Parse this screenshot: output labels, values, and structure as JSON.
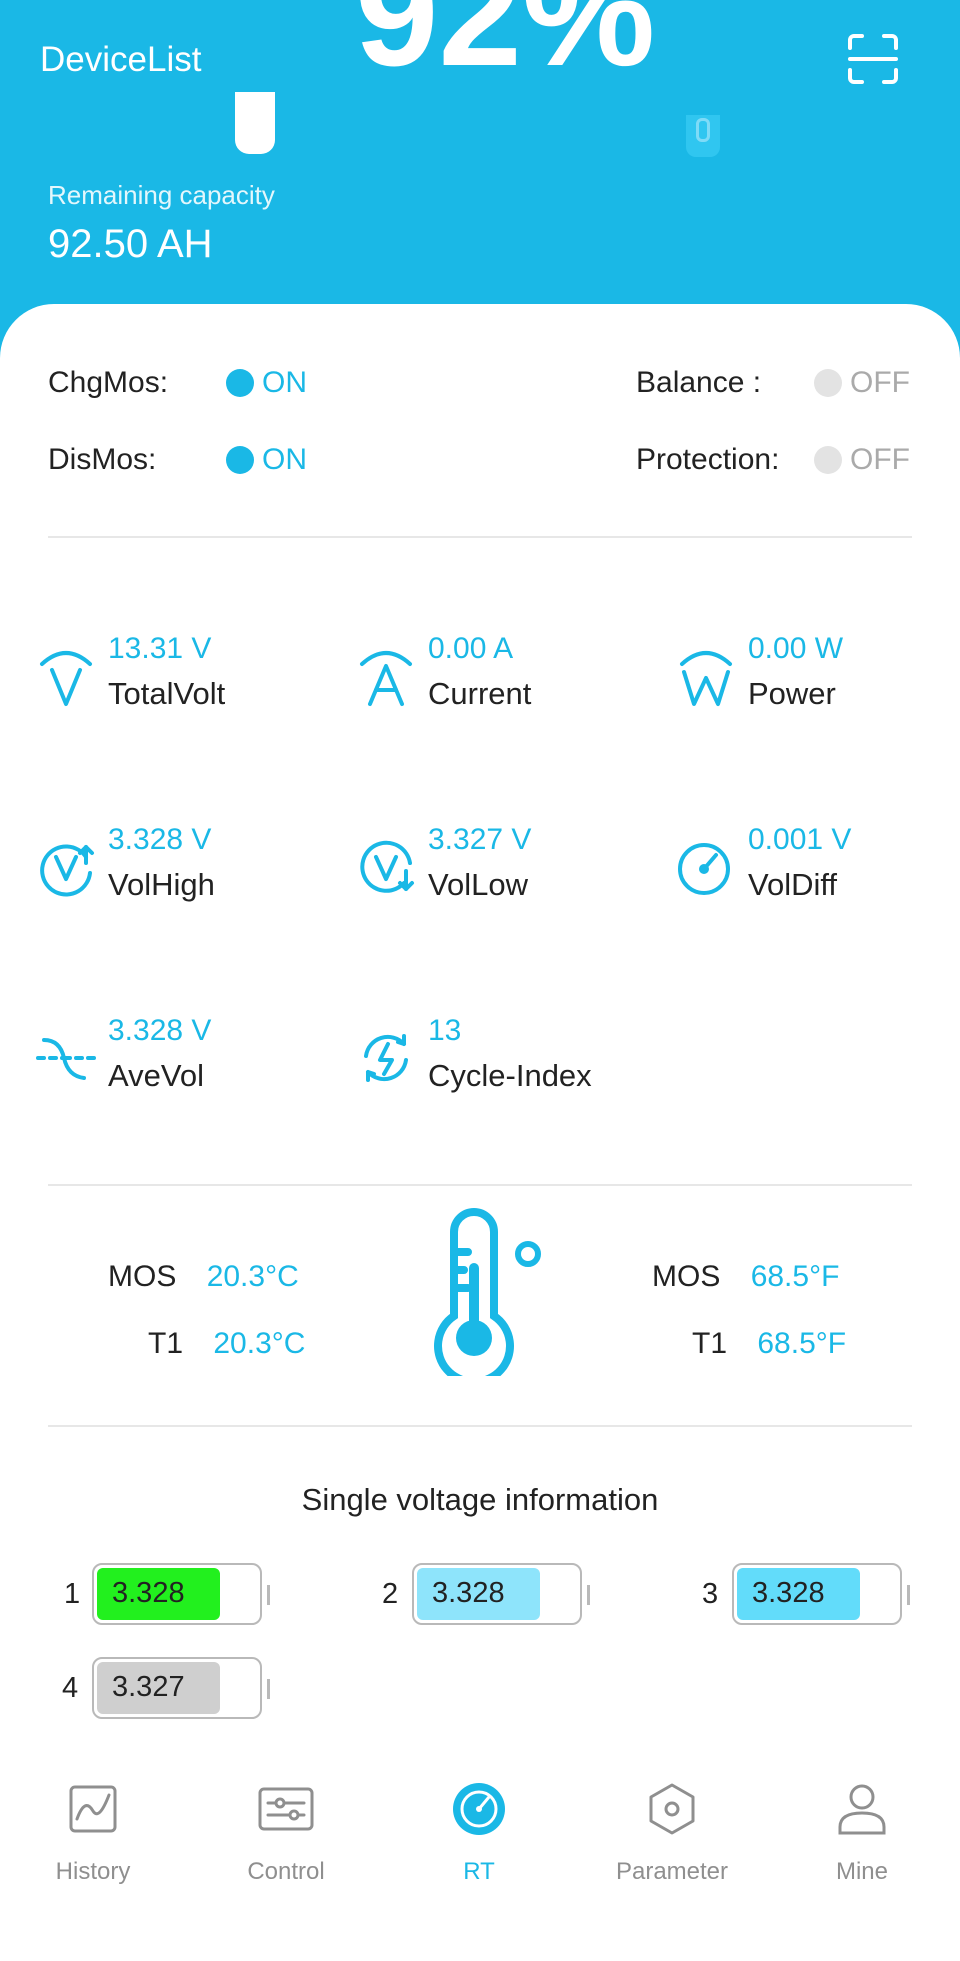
{
  "header": {
    "title": "DeviceList",
    "remaining_label": "Remaining capacity",
    "remaining_value": "92.50 AH",
    "percent_partial": "92%"
  },
  "switches": {
    "chgmos": {
      "label": "ChgMos:",
      "state": "ON"
    },
    "dismos": {
      "label": "DisMos:",
      "state": "ON"
    },
    "balance": {
      "label": "Balance :",
      "state": "OFF"
    },
    "protection": {
      "label": "Protection:",
      "state": "OFF"
    }
  },
  "metrics": [
    {
      "icon": "volt-icon",
      "value": "13.31 V",
      "label": "TotalVolt"
    },
    {
      "icon": "ampere-icon",
      "value": "0.00 A",
      "label": "Current"
    },
    {
      "icon": "watt-icon",
      "value": "0.00 W",
      "label": "Power"
    },
    {
      "icon": "volt-high-icon",
      "value": "3.328 V",
      "label": "VolHigh"
    },
    {
      "icon": "volt-low-icon",
      "value": "3.327 V",
      "label": "VolLow"
    },
    {
      "icon": "gauge-icon",
      "value": "0.001 V",
      "label": "VolDiff"
    },
    {
      "icon": "average-wave-icon",
      "value": "3.328 V",
      "label": "AveVol"
    },
    {
      "icon": "cycle-lightning-icon",
      "value": "13",
      "label": "Cycle-Index"
    }
  ],
  "temperature": {
    "celsius": [
      {
        "label": "MOS",
        "value": "20.3°C"
      },
      {
        "label": "T1",
        "value": "20.3°C"
      }
    ],
    "fahrenheit": [
      {
        "label": "MOS",
        "value": "68.5°F"
      },
      {
        "label": "T1",
        "value": "68.5°F"
      }
    ]
  },
  "single_voltage": {
    "title": "Single voltage information",
    "cells": [
      {
        "index": "1",
        "value": "3.328",
        "color": "#22f01e",
        "level": 0.77
      },
      {
        "index": "2",
        "value": "3.328",
        "color": "#8ee4fb",
        "level": 0.77
      },
      {
        "index": "3",
        "value": "3.328",
        "color": "#62dcfa",
        "level": 0.77
      },
      {
        "index": "4",
        "value": "3.327",
        "color": "#cfcfcf",
        "level": 0.77
      }
    ]
  },
  "tabs": [
    {
      "label": "History",
      "icon": "chart-icon",
      "active": false
    },
    {
      "label": "Control",
      "icon": "sliders-icon",
      "active": false
    },
    {
      "label": "RT",
      "icon": "gauge-icon",
      "active": true
    },
    {
      "label": "Parameter",
      "icon": "hexagon-icon",
      "active": false
    },
    {
      "label": "Mine",
      "icon": "person-icon",
      "active": false
    }
  ],
  "colors": {
    "accent": "#1ab8e6",
    "off_gray": "#aaaaaa"
  }
}
